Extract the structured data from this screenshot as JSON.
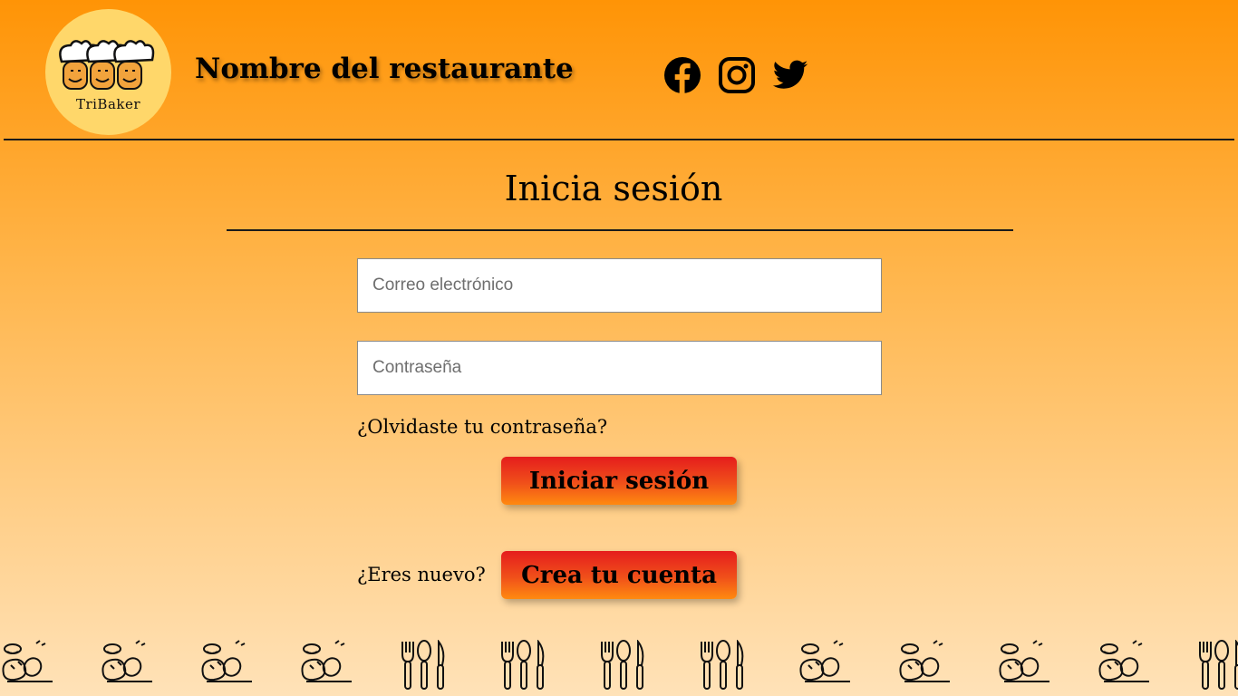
{
  "header": {
    "logo_text": "TriBaker",
    "restaurant_name": "Nombre del restaurante",
    "social": [
      {
        "name": "facebook-icon"
      },
      {
        "name": "instagram-icon"
      },
      {
        "name": "twitter-icon"
      }
    ]
  },
  "login": {
    "title": "Inicia sesión",
    "email_placeholder": "Correo electrónico",
    "password_placeholder": "Contraseña",
    "forgot_password": "¿Olvidaste tu contraseña?",
    "login_button": "Iniciar sesión",
    "new_user_label": "¿Eres nuevo?",
    "create_account_button": "Crea tu cuenta"
  },
  "footer": {
    "pattern": [
      "cooking-icon",
      "cooking-icon",
      "cooking-icon",
      "cooking-icon",
      "cutlery-icon",
      "cutlery-icon",
      "cutlery-icon",
      "cutlery-icon",
      "cooking-icon",
      "cooking-icon",
      "cooking-icon",
      "cooking-icon",
      "cutlery-icon"
    ]
  },
  "colors": {
    "background_top": "#ff9406",
    "background_bottom": "#ffe2b8",
    "logo_circle": "#ffd76a",
    "button_top": "#e51d1d",
    "button_bottom": "#ff8a10"
  }
}
